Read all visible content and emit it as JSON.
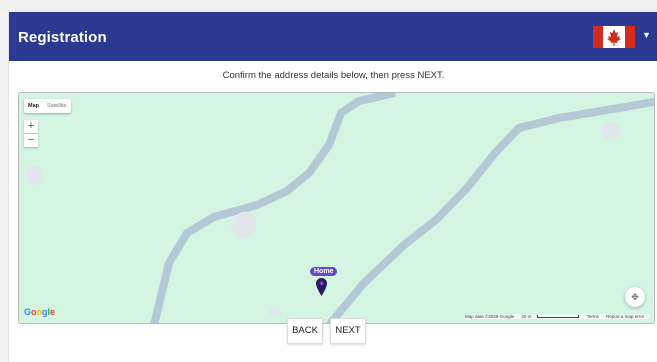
{
  "header": {
    "title": "Registration",
    "bg_color": "#2b3990",
    "flag_icon": "canada-flag-icon",
    "dropdown_icon": "caret-down-icon"
  },
  "instruction": "Confirm the address details below, then press NEXT.",
  "map": {
    "type_controls": {
      "map_label": "Map",
      "satellite_label": "Satellite",
      "selected": "Map"
    },
    "zoom_in_label": "+",
    "zoom_out_label": "−",
    "logo": {
      "g1": "G",
      "o1": "o",
      "o2": "o",
      "g2": "g",
      "l": "l",
      "e": "e"
    },
    "attribution": {
      "data": "Map data ©2026 Google",
      "scale": "20 m",
      "terms": "Terms",
      "report": "Report a map error"
    },
    "marker_label": "Home",
    "recenter_icon": "recenter-icon",
    "land_color": "#d3f5e2",
    "road_color": "#b5c8d6"
  },
  "buttons": {
    "back": "BACK",
    "next": "NEXT"
  }
}
